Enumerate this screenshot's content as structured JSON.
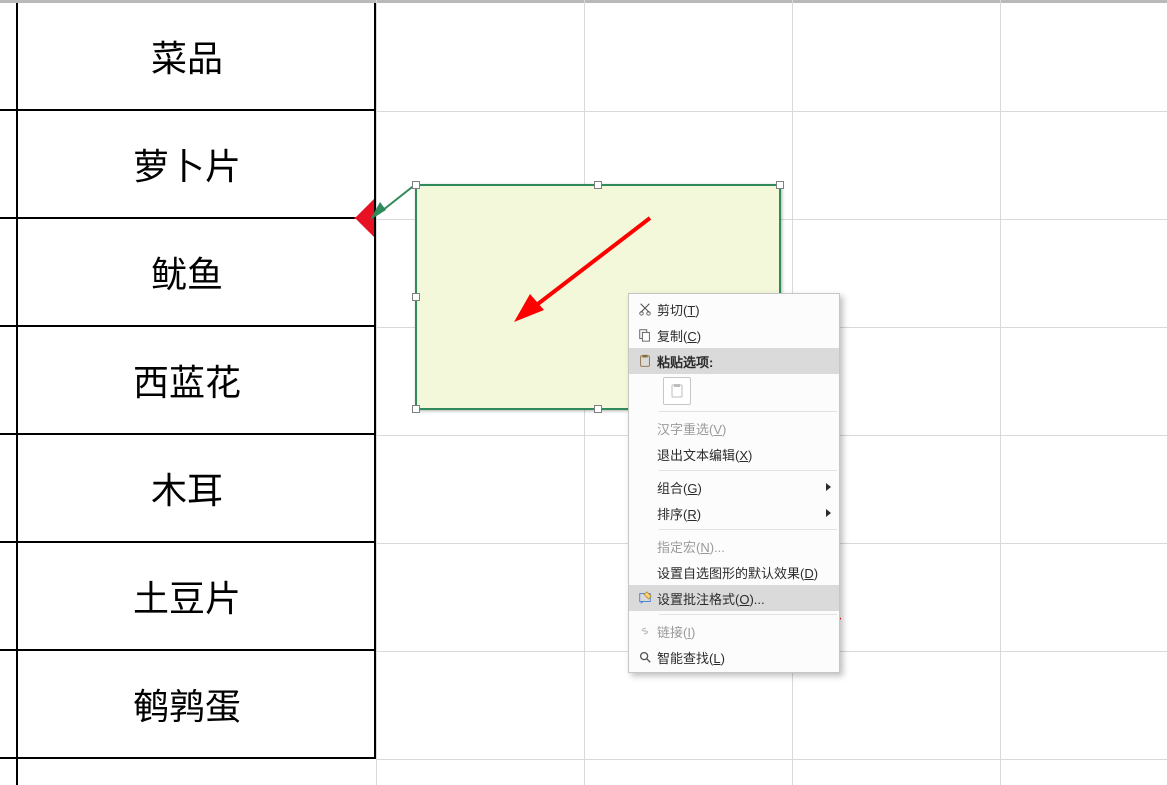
{
  "column_data": {
    "header": "菜品",
    "rows": [
      "萝卜片",
      "鱿鱼",
      "西蓝花",
      "木耳",
      "土豆片",
      "鹌鹑蛋"
    ]
  },
  "context_menu": {
    "cut": {
      "label": "剪切(",
      "accel": "T",
      "suffix": ")"
    },
    "copy": {
      "label": "复制(",
      "accel": "C",
      "suffix": ")"
    },
    "paste_header": {
      "label": "粘贴选项:"
    },
    "ime": {
      "label": "汉字重选(",
      "accel": "V",
      "suffix": ")"
    },
    "exit_text": {
      "label": "退出文本编辑(",
      "accel": "X",
      "suffix": ")"
    },
    "group": {
      "label": "组合(",
      "accel": "G",
      "suffix": ")"
    },
    "order": {
      "label": "排序(",
      "accel": "R",
      "suffix": ")"
    },
    "macro": {
      "label": "指定宏(",
      "accel": "N",
      "suffix": ")..."
    },
    "defaults": {
      "label": "设置自选图形的默认效果(",
      "accel": "D",
      "suffix": ")"
    },
    "format": {
      "label": "设置批注格式(",
      "accel": "O",
      "suffix": ")..."
    },
    "link": {
      "label": "链接(",
      "accel": "I",
      "suffix": ")"
    },
    "lookup": {
      "label": "智能查找(",
      "accel": "L",
      "suffix": ")"
    }
  },
  "icons": {
    "cut": "cut-icon",
    "copy": "copy-icon",
    "paste": "paste-icon",
    "clipboard": "clipboard-icon",
    "format": "format-comment-icon",
    "link": "link-icon",
    "lookup": "search-icon"
  },
  "colors": {
    "comment_bg": "#f4f8da",
    "comment_border": "#2f8b5b",
    "annotation_arrow": "#ff0000",
    "flag": "#e81123"
  }
}
